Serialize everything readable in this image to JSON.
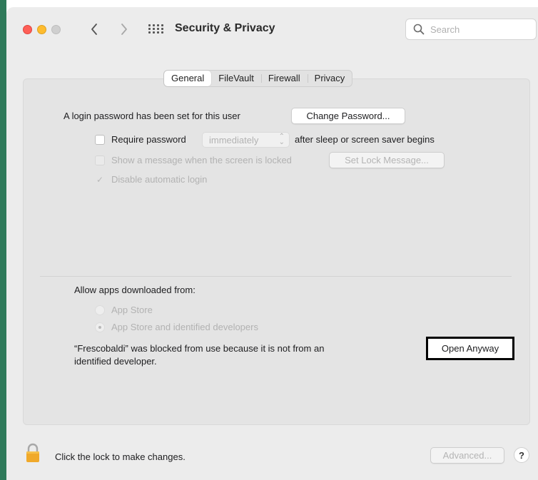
{
  "window": {
    "title": "Security & Privacy",
    "search_placeholder": "Search"
  },
  "tabs": [
    {
      "label": "General",
      "active": true
    },
    {
      "label": "FileVault",
      "active": false
    },
    {
      "label": "Firewall",
      "active": false
    },
    {
      "label": "Privacy",
      "active": false
    }
  ],
  "general": {
    "login_password_text": "A login password has been set for this user",
    "change_password_button": "Change Password...",
    "require_password": {
      "label": "Require password",
      "checked": false,
      "interval_value": "immediately",
      "suffix": "after sleep or screen saver begins"
    },
    "show_message": {
      "label": "Show a message when the screen is locked",
      "checked": false,
      "enabled": false,
      "button": "Set Lock Message..."
    },
    "disable_auto_login": {
      "label": "Disable automatic login",
      "checked": true,
      "enabled": false
    }
  },
  "allow_apps": {
    "heading": "Allow apps downloaded from:",
    "options": [
      {
        "label": "App Store",
        "selected": false
      },
      {
        "label": "App Store and identified developers",
        "selected": true
      }
    ],
    "blocked_message_line1": "“Frescobaldi” was blocked from use because it is not from an",
    "blocked_message_line2": "identified developer.",
    "open_anyway_button": "Open Anyway"
  },
  "footer": {
    "lock_text": "Click the lock to make changes.",
    "advanced_button": "Advanced...",
    "help_label": "?"
  },
  "colors": {
    "close": "#fe5f57",
    "minimize": "#febc2e",
    "zoom_inactive": "#cfcfcf",
    "lock_icon": "#f0a92a",
    "highlight_border": "#000000"
  }
}
